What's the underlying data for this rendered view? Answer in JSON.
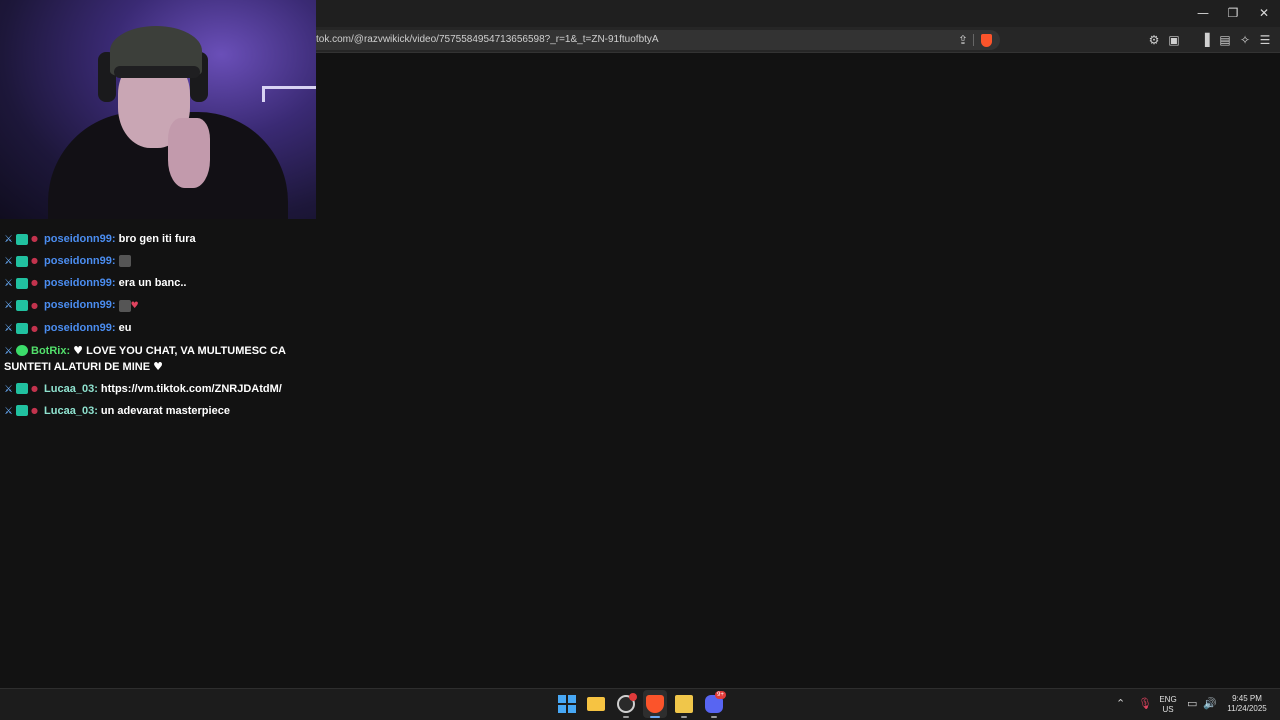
{
  "browser": {
    "url": "tok.com/@razvwikick/video/7575584954713656598?_r=1&_t=ZN-91ftuofbtyA",
    "window_controls": {
      "minimize": "—",
      "restore": "❐",
      "close": "✕"
    }
  },
  "chat": {
    "messages": [
      {
        "user": "poseidonn99:",
        "text": "bro gen iti fura",
        "user_color": "blue"
      },
      {
        "user": "poseidonn99:",
        "text": "",
        "emote": "emote-image",
        "user_color": "blue"
      },
      {
        "user": "poseidonn99:",
        "text": "era un banc..",
        "user_color": "blue"
      },
      {
        "user": "poseidonn99:",
        "text": "",
        "emote": "emote-image-heart",
        "user_color": "blue"
      },
      {
        "user": "poseidonn99:",
        "text": "eu",
        "user_color": "blue"
      },
      {
        "user": "BotRix:",
        "text": "LOVE YOU CHAT, VA MULTUMESC CA SUNTETI ALATURI DE MINE",
        "user_color": "green"
      },
      {
        "user": "Lucaa_03:",
        "text": "https://vm.tiktok.com/ZNRJDAtdM/",
        "user_color": "teal"
      },
      {
        "user": "Lucaa_03:",
        "text": "un adevarat masterpiece",
        "user_color": "teal"
      }
    ]
  },
  "taskbar": {
    "language_top": "ENG",
    "language_bottom": "US",
    "time": "9:45 PM",
    "date": "11/24/2025",
    "discord_badge": "9+"
  },
  "colors": {
    "user_blue": "#4b8df0",
    "user_green": "#52e06b",
    "user_teal": "#8fe2cf",
    "brave_orange": "#fb542b"
  }
}
